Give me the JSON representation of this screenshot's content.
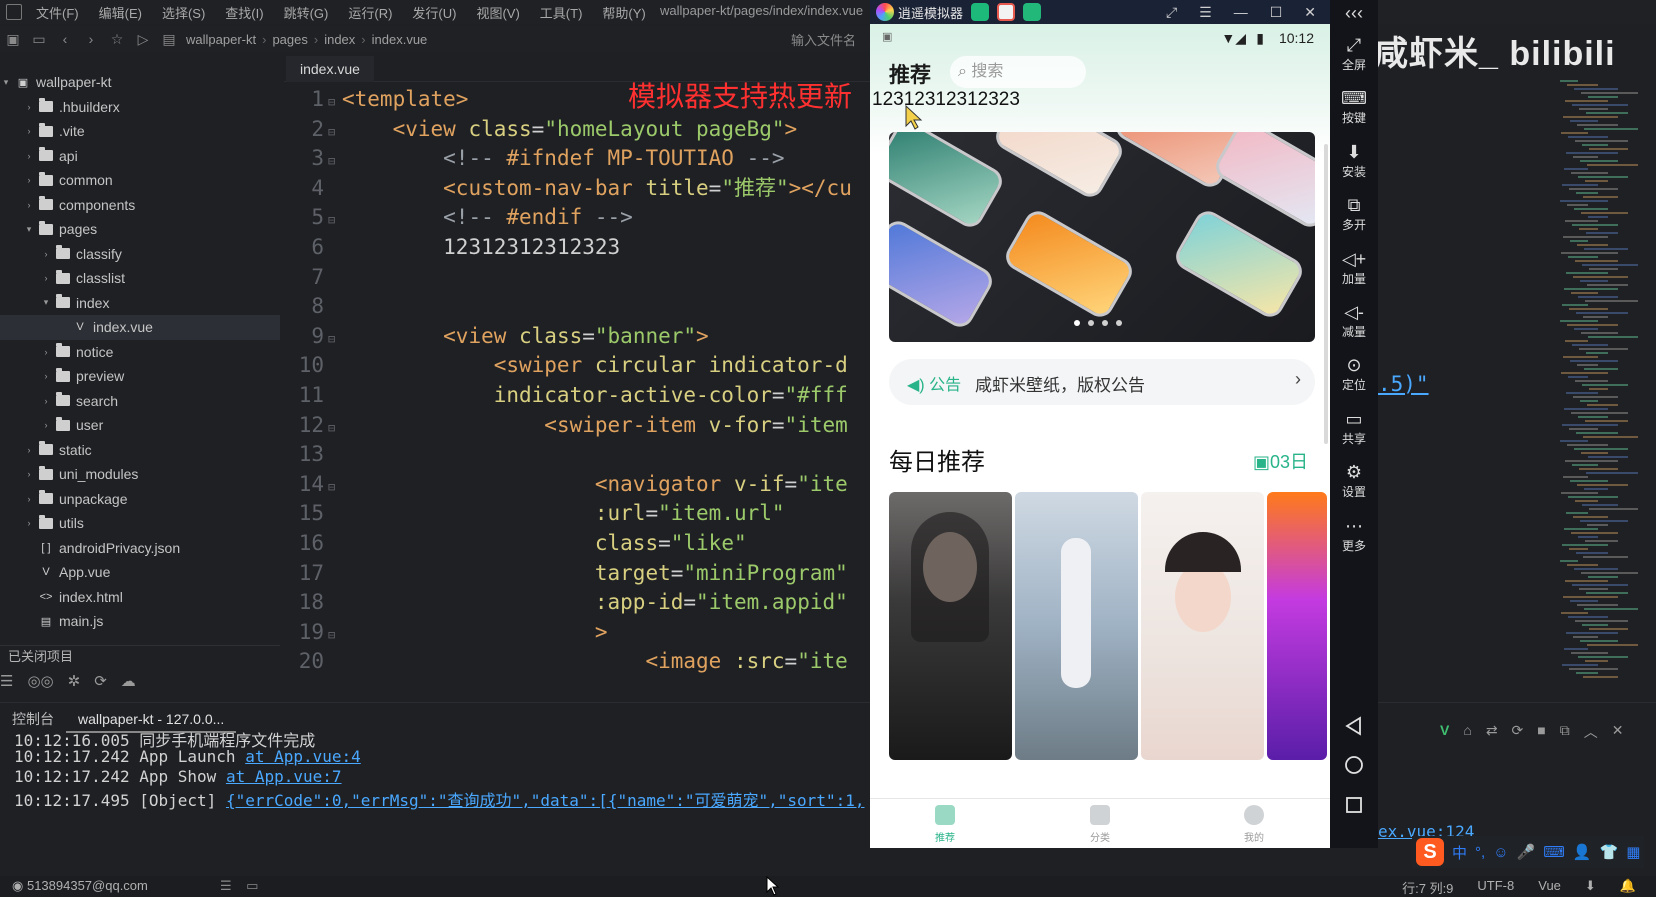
{
  "menubar": {
    "items": [
      "文件(F)",
      "编辑(E)",
      "选择(S)",
      "查找(I)",
      "跳转(G)",
      "运行(R)",
      "发行(U)",
      "视图(V)",
      "工具(T)",
      "帮助(Y)"
    ],
    "window_title": "wallpaper-kt/pages/index/index.vue"
  },
  "toolbar": {
    "breadcrumb": [
      "wallpaper-kt",
      "pages",
      "index",
      "index.vue"
    ],
    "search_file_placeholder": "输入文件名"
  },
  "sidebar": {
    "project": "wallpaper-kt",
    "items": [
      {
        "label": ".hbuilderx",
        "kind": "folder",
        "depth": 1,
        "expanded": false
      },
      {
        "label": ".vite",
        "kind": "folder",
        "depth": 1,
        "expanded": false
      },
      {
        "label": "api",
        "kind": "folder",
        "depth": 1,
        "expanded": false
      },
      {
        "label": "common",
        "kind": "folder",
        "depth": 1,
        "expanded": false
      },
      {
        "label": "components",
        "kind": "folder",
        "depth": 1,
        "expanded": false
      },
      {
        "label": "pages",
        "kind": "folder",
        "depth": 1,
        "expanded": true
      },
      {
        "label": "classify",
        "kind": "folder",
        "depth": 2,
        "expanded": false
      },
      {
        "label": "classlist",
        "kind": "folder",
        "depth": 2,
        "expanded": false
      },
      {
        "label": "index",
        "kind": "folder",
        "depth": 2,
        "expanded": true
      },
      {
        "label": "index.vue",
        "kind": "file-v",
        "depth": 3,
        "selected": true
      },
      {
        "label": "notice",
        "kind": "folder",
        "depth": 2,
        "expanded": false
      },
      {
        "label": "preview",
        "kind": "folder",
        "depth": 2,
        "expanded": false
      },
      {
        "label": "search",
        "kind": "folder",
        "depth": 2,
        "expanded": false
      },
      {
        "label": "user",
        "kind": "folder",
        "depth": 2,
        "expanded": false
      },
      {
        "label": "static",
        "kind": "folder",
        "depth": 1,
        "expanded": false
      },
      {
        "label": "uni_modules",
        "kind": "folder",
        "depth": 1,
        "expanded": false
      },
      {
        "label": "unpackage",
        "kind": "folder",
        "depth": 1,
        "expanded": false
      },
      {
        "label": "utils",
        "kind": "folder",
        "depth": 1,
        "expanded": false
      },
      {
        "label": "androidPrivacy.json",
        "kind": "file-json",
        "depth": 1
      },
      {
        "label": "App.vue",
        "kind": "file-v",
        "depth": 1
      },
      {
        "label": "index.html",
        "kind": "file-html",
        "depth": 1
      },
      {
        "label": "main.js",
        "kind": "file-js",
        "depth": 1
      }
    ],
    "closed_projects": "已关闭项目"
  },
  "editor": {
    "tab": "index.vue",
    "hot_reload_note": "模拟器支持热更新",
    "lines": [
      {
        "n": "1",
        "fold": "⊟",
        "indent": 0,
        "parts": [
          [
            "t-tag",
            "<template>"
          ]
        ]
      },
      {
        "n": "2",
        "fold": "⊟",
        "indent": 1,
        "parts": [
          [
            "t-tag",
            "<view "
          ],
          [
            "t-attr",
            "class"
          ],
          [
            "t-txt",
            "="
          ],
          [
            "t-str",
            "\"homeLayout pageBg\""
          ],
          [
            "t-tag",
            ">"
          ]
        ]
      },
      {
        "n": "3",
        "fold": "⊟",
        "indent": 2,
        "parts": [
          [
            "t-com",
            "<!-- "
          ],
          [
            "t-com-key",
            "#ifndef MP-TOUTIAO"
          ],
          [
            "t-com",
            " -->"
          ]
        ]
      },
      {
        "n": "4",
        "fold": "",
        "indent": 2,
        "parts": [
          [
            "t-tag",
            "<custom-nav-bar "
          ],
          [
            "t-attr",
            "title"
          ],
          [
            "t-txt",
            "="
          ],
          [
            "t-str",
            "\"推荐\""
          ],
          [
            "t-tag",
            "></cu"
          ]
        ]
      },
      {
        "n": "5",
        "fold": "⊟",
        "indent": 2,
        "parts": [
          [
            "t-com",
            "<!-- "
          ],
          [
            "t-com-key",
            "#endif"
          ],
          [
            "t-com",
            " -->"
          ]
        ]
      },
      {
        "n": "6",
        "fold": "",
        "indent": 2,
        "parts": [
          [
            "t-txt",
            "12312312312323"
          ]
        ]
      },
      {
        "n": "7",
        "fold": "",
        "indent": 0,
        "parts": []
      },
      {
        "n": "8",
        "fold": "",
        "indent": 0,
        "parts": []
      },
      {
        "n": "9",
        "fold": "⊟",
        "indent": 2,
        "parts": [
          [
            "t-tag",
            "<view "
          ],
          [
            "t-attr",
            "class"
          ],
          [
            "t-txt",
            "="
          ],
          [
            "t-str",
            "\"banner\""
          ],
          [
            "t-tag",
            ">"
          ]
        ]
      },
      {
        "n": "10",
        "fold": "",
        "indent": 3,
        "parts": [
          [
            "t-tag",
            "<swiper "
          ],
          [
            "t-attr",
            "circular indicator-d"
          ]
        ]
      },
      {
        "n": "11",
        "fold": "",
        "indent": 3,
        "parts": [
          [
            "t-attr",
            "indicator-active-color"
          ],
          [
            "t-txt",
            "="
          ],
          [
            "t-str",
            "\"#fff"
          ]
        ]
      },
      {
        "n": "12",
        "fold": "⊟",
        "indent": 4,
        "parts": [
          [
            "t-tag",
            "<swiper-item "
          ],
          [
            "t-attr",
            "v-for"
          ],
          [
            "t-txt",
            "="
          ],
          [
            "t-str",
            "\"item"
          ]
        ]
      },
      {
        "n": "13",
        "fold": "",
        "indent": 0,
        "parts": []
      },
      {
        "n": "14",
        "fold": "⊟",
        "indent": 5,
        "parts": [
          [
            "t-tag",
            "<navigator "
          ],
          [
            "t-attr",
            "v-if"
          ],
          [
            "t-txt",
            "="
          ],
          [
            "t-str",
            "\"ite"
          ]
        ]
      },
      {
        "n": "15",
        "fold": "",
        "indent": 5,
        "parts": [
          [
            "t-attr",
            ":url"
          ],
          [
            "t-txt",
            "="
          ],
          [
            "t-str",
            "\"item.url\""
          ]
        ]
      },
      {
        "n": "16",
        "fold": "",
        "indent": 5,
        "parts": [
          [
            "t-attr",
            "class"
          ],
          [
            "t-txt",
            "="
          ],
          [
            "t-str",
            "\"like\""
          ]
        ]
      },
      {
        "n": "17",
        "fold": "",
        "indent": 5,
        "parts": [
          [
            "t-attr",
            "target"
          ],
          [
            "t-txt",
            "="
          ],
          [
            "t-str",
            "\"miniProgram\""
          ]
        ]
      },
      {
        "n": "18",
        "fold": "",
        "indent": 5,
        "parts": [
          [
            "t-attr",
            ":app-id"
          ],
          [
            "t-txt",
            "="
          ],
          [
            "t-str",
            "\"item.appid\""
          ]
        ]
      },
      {
        "n": "19",
        "fold": "⊟",
        "indent": 5,
        "parts": [
          [
            "t-tag",
            ">"
          ]
        ]
      },
      {
        "n": "20",
        "fold": "",
        "indent": 6,
        "parts": [
          [
            "t-tag",
            "<image "
          ],
          [
            "t-attr",
            ":src"
          ],
          [
            "t-txt",
            "="
          ],
          [
            "t-str",
            "\"ite"
          ]
        ]
      }
    ],
    "right_fragment": ".5)\""
  },
  "console": {
    "tabs": [
      "控制台",
      "wallpaper-kt - 127.0.0..."
    ],
    "logs": [
      {
        "time": "10:12:16.005",
        "text": "同步手机端程序文件完成",
        "link": ""
      },
      {
        "time": "10:12:17.242",
        "text": "App Launch",
        "link": "at App.vue:4"
      },
      {
        "time": "10:12:17.242",
        "text": "App Show",
        "link": "at App.vue:7"
      },
      {
        "time": "10:12:17.495",
        "text": "[Object]",
        "link": "{\"errCode\":0,\"errMsg\":\"查询成功\",\"data\":[{\"name\":\"可爱萌宠\",\"sort\":1,"
      }
    ],
    "right_link": "ex.vue:124"
  },
  "statusbar": {
    "user": "513894357@qq.com",
    "position": "行:7  列:9",
    "encoding": "UTF-8",
    "language": "Vue"
  },
  "watermark": "咸虾米_ bilibili",
  "emulator": {
    "title": "逍遥模拟器",
    "side_buttons": [
      "全屏",
      "按键",
      "安装",
      "多开",
      "加量",
      "减量",
      "定位",
      "共享",
      "设置",
      "更多"
    ],
    "phone": {
      "time": "10:12",
      "page_title": "推荐",
      "search_placeholder": "搜索",
      "numbers": "12312312312323",
      "notice_tag": "公告",
      "notice_text": "咸虾米壁纸，版权公告",
      "daily_title": "每日推荐",
      "daily_date": "03日",
      "tabs": [
        "推荐",
        "分类",
        "我的"
      ]
    }
  },
  "ime": {
    "logo": "S",
    "label": "中"
  },
  "colors": {
    "accent": "#28b389",
    "hot_note": "#ff3030",
    "link": "#4aa8ff"
  }
}
